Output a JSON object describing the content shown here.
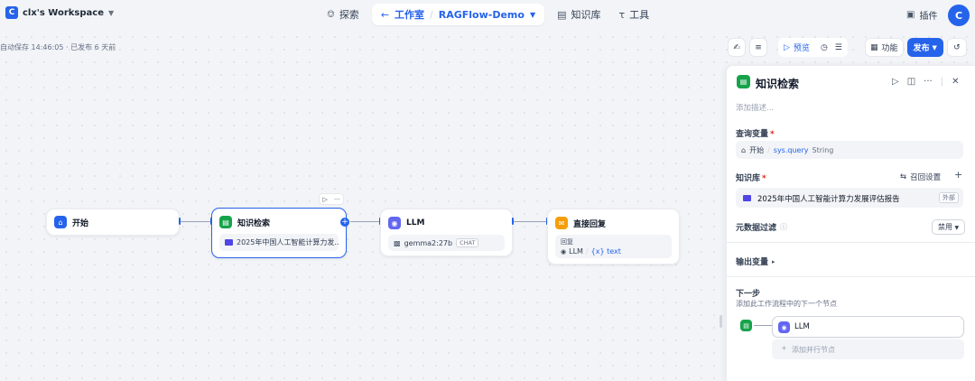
{
  "workspace": {
    "logo_letter": "C",
    "name": "clx's Workspace"
  },
  "nav": {
    "explore": "探索",
    "studio": "工作室",
    "app_name": "RAGFlow-Demo",
    "knowledge": "知识库",
    "tools": "工具"
  },
  "plugins_label": "插件",
  "avatar_letter": "C",
  "autosave": "自动保存 14:46:05 · 已发布 6 天前",
  "toolbar": {
    "preview": "预览",
    "features": "功能",
    "publish": "发布"
  },
  "nodes": {
    "start": {
      "title": "开始"
    },
    "knowledge": {
      "title": "知识检索",
      "dataset": "2025年中国人工智能计算力发..."
    },
    "llm": {
      "title": "LLM",
      "model": "gemma2:27b",
      "mode": "CHAT"
    },
    "answer": {
      "title": "直接回复",
      "label": "回复",
      "src": "LLM",
      "var": "{x} text"
    }
  },
  "panel": {
    "title": "知识检索",
    "desc_placeholder": "添加描述...",
    "query_label": "查询变量",
    "query_node": "开始",
    "query_var": "sys.query",
    "query_type": "String",
    "kb_label": "知识库",
    "recall_settings": "召回设置",
    "kb_item": "2025年中国人工智能计算力发展评估报告",
    "kb_tag": "外部",
    "metadata_label": "元数据过滤",
    "metadata_value": "禁用",
    "output_label": "输出变量",
    "next_title": "下一步",
    "next_desc": "添加此工作流程中的下一个节点",
    "next_node": "LLM",
    "add_parallel": "添加并行节点"
  },
  "colors": {
    "accent": "#2563eb",
    "start_icon": "#2563eb",
    "knowledge_icon": "#16a34a",
    "llm_icon": "#6366f1",
    "answer_icon": "#f59e0b",
    "folder": "#4f46e5"
  }
}
